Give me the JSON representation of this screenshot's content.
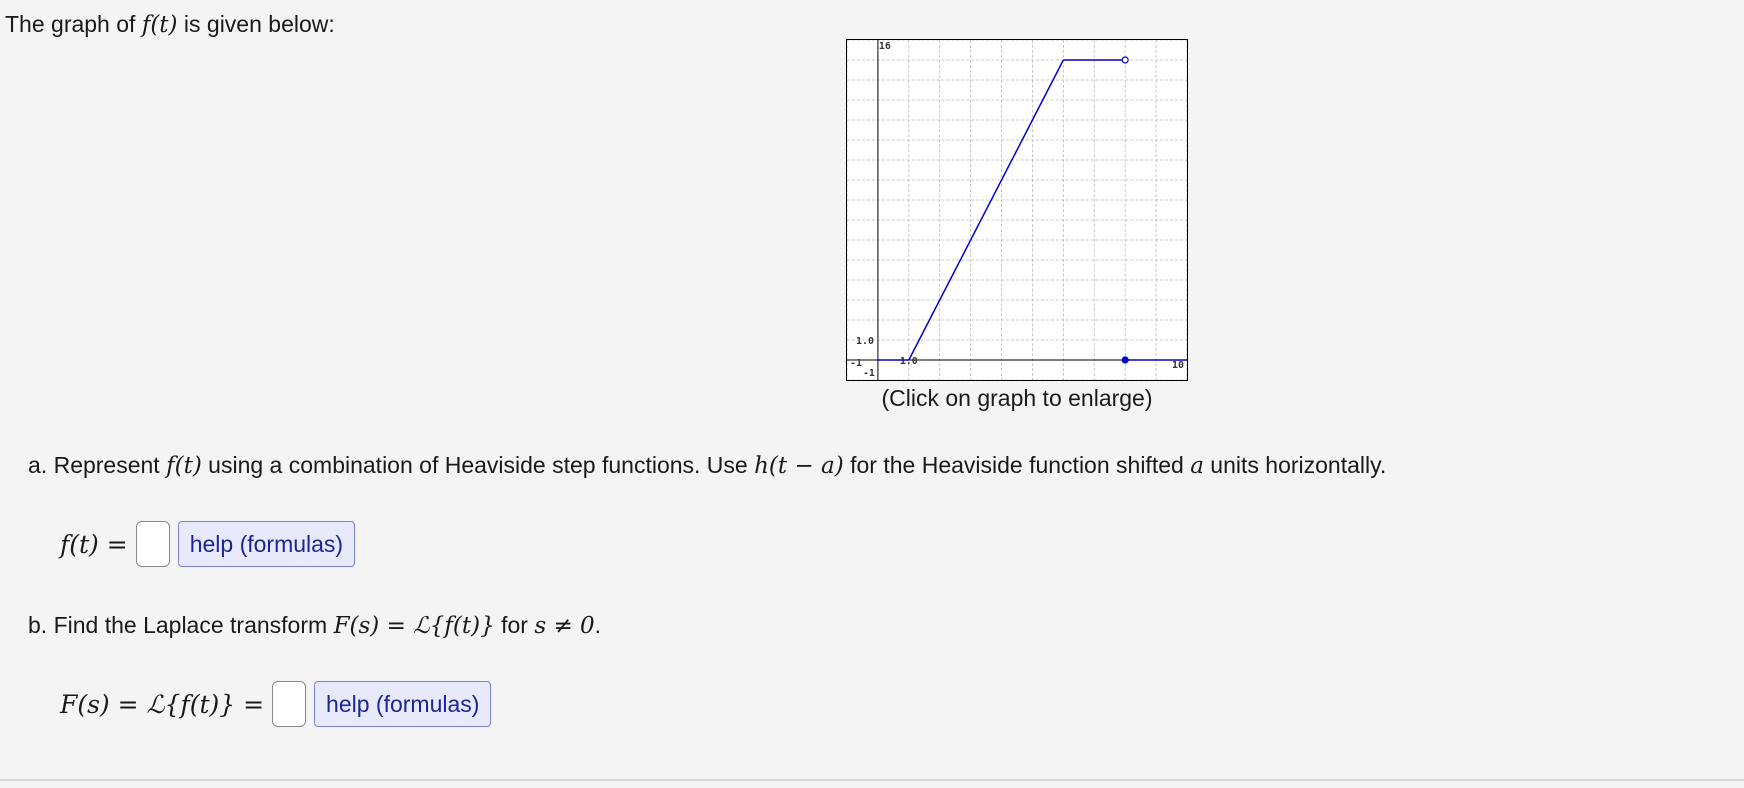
{
  "intro": {
    "text_before": "The graph of ",
    "func": "f(t)",
    "text_after": " is given below:"
  },
  "graph": {
    "caption": "(Click on graph to enlarge)",
    "tick_labels": {
      "x_min": "-1",
      "x_max": "10",
      "x_one": "1.0",
      "y_min": "-1",
      "y_max": "16",
      "y_one": "1.0"
    },
    "line_color": "#0000cc",
    "chart_data": {
      "type": "line",
      "xlim": [
        -1,
        10
      ],
      "ylim": [
        -1,
        16
      ],
      "grid": true,
      "series": [
        {
          "x": [
            0,
            1
          ],
          "y": [
            0,
            0
          ]
        },
        {
          "x": [
            1,
            6
          ],
          "y": [
            0,
            15
          ]
        },
        {
          "x": [
            6,
            8
          ],
          "y": [
            15,
            15
          ]
        },
        {
          "x": [
            8,
            10
          ],
          "y": [
            0,
            0
          ]
        }
      ],
      "points": [
        {
          "x": 8,
          "y": 15,
          "style": "open"
        },
        {
          "x": 8,
          "y": 0,
          "style": "filled"
        }
      ]
    }
  },
  "part_a": {
    "prefix": "a.",
    "text1": "Represent ",
    "func": "f(t)",
    "text2": " using a combination of Heaviside step functions. Use ",
    "heaviside": "h(t − a)",
    "text3": " for the Heaviside function shifted ",
    "a_var": "a",
    "text4": " units horizontally.",
    "answer_label": "f(t) =",
    "answer_value": "",
    "help_label": "help (formulas)"
  },
  "part_b": {
    "prefix": "b.",
    "text1": "Find the Laplace transform ",
    "transform": "F(s) = ℒ{f(t)}",
    "text2": " for ",
    "condition": "s ≠ 0",
    "text3": ".",
    "answer_label": "F(s) = ℒ{f(t)} =",
    "answer_value": "",
    "help_label": "help (formulas)"
  }
}
